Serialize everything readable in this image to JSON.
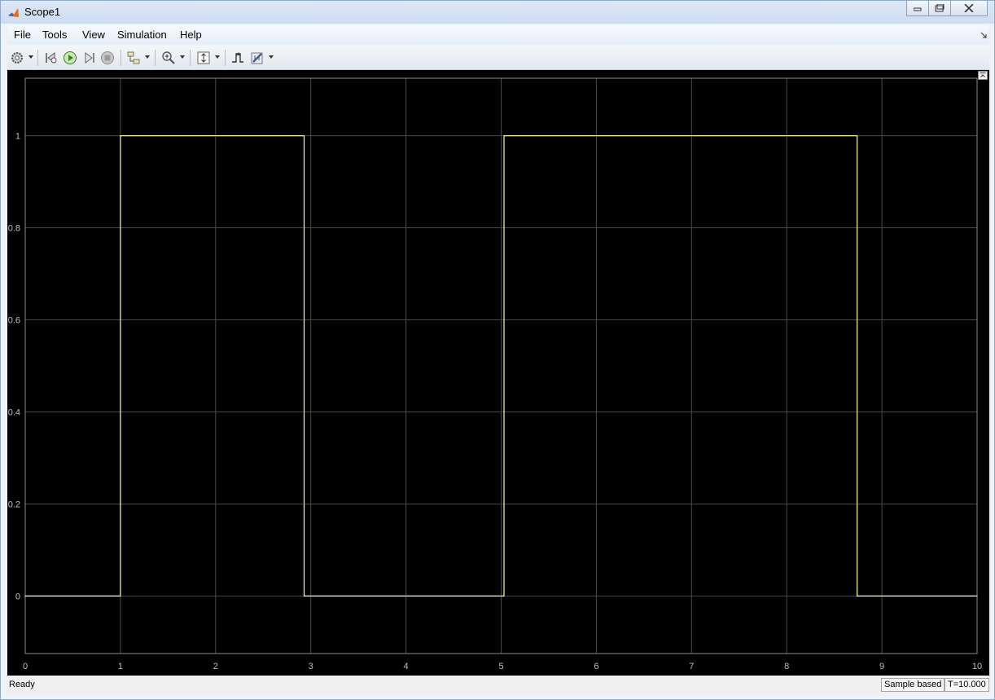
{
  "window": {
    "title": "Scope1",
    "app_icon": "matlab-icon"
  },
  "menu": [
    "File",
    "Tools",
    "View",
    "Simulation",
    "Help"
  ],
  "toolbar": [
    {
      "name": "settings-icon",
      "dropdown": true
    },
    {
      "name": "step-back-icon"
    },
    {
      "name": "run-icon"
    },
    {
      "name": "step-forward-icon"
    },
    {
      "name": "stop-icon"
    },
    {
      "name": "highlight-simulink-block-icon",
      "dropdown": true
    },
    {
      "name": "zoom-in-icon",
      "dropdown": true
    },
    {
      "name": "scale-axes-icon",
      "dropdown": true
    },
    {
      "name": "triggers-icon"
    },
    {
      "name": "cursor-measurements-icon",
      "dropdown": true
    }
  ],
  "colors": {
    "background": "#000000",
    "grid": "#4a4a4a",
    "signal": "#ffffa0",
    "ticks": "#bfbfbf"
  },
  "chart_data": {
    "type": "line",
    "xlim": [
      0,
      10
    ],
    "ylim": [
      -0.125,
      1.125
    ],
    "xticks": [
      "0",
      "1",
      "2",
      "3",
      "4",
      "5",
      "6",
      "7",
      "8",
      "9",
      "10"
    ],
    "yticks": [
      "0",
      "0.2",
      "0.4",
      "0.6",
      "0.8",
      "1"
    ],
    "grid": true,
    "series": [
      {
        "x": [
          0,
          1,
          1,
          2.93,
          2.93,
          5.03,
          5.03,
          8.74,
          8.74,
          10
        ],
        "y": [
          0,
          0,
          1,
          1,
          0,
          0,
          1,
          1,
          0,
          0
        ]
      }
    ]
  },
  "status": {
    "text": "Ready",
    "mode": "Sample based",
    "time": "T=10.000"
  }
}
